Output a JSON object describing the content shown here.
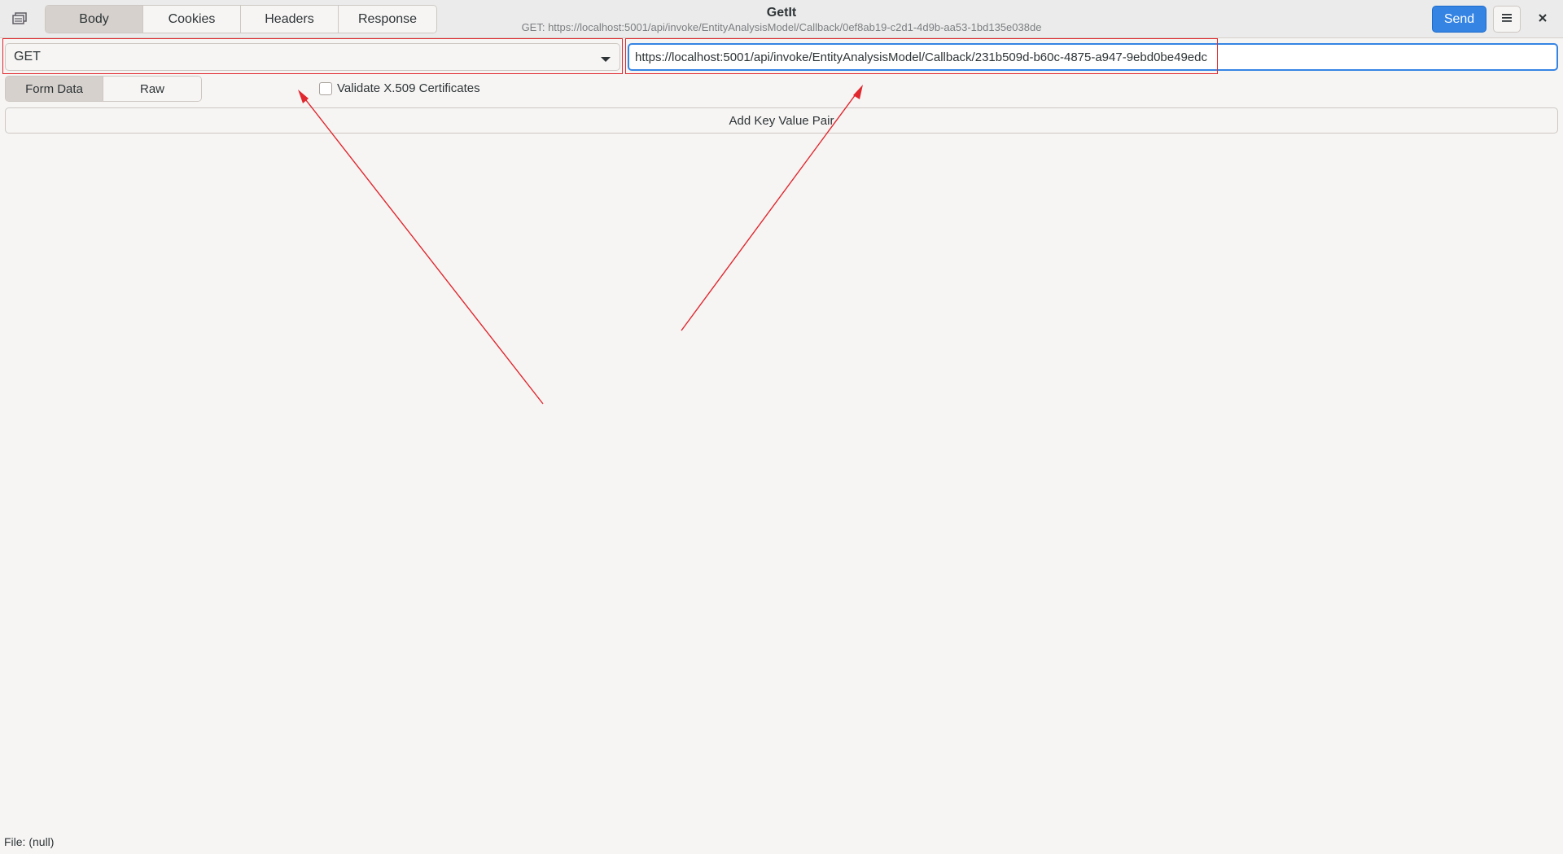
{
  "window": {
    "title": "GetIt",
    "subtitle": "GET: https://localhost:5001/api/invoke/EntityAnalysisModel/Callback/0ef8ab19-c2d1-4d9b-aa53-1bd135e038de"
  },
  "header": {
    "app_icon": "window-stack-icon",
    "tabs": [
      {
        "label": "Body",
        "active": true
      },
      {
        "label": "Cookies",
        "active": false
      },
      {
        "label": "Headers",
        "active": false
      },
      {
        "label": "Response",
        "active": false
      }
    ],
    "send_label": "Send",
    "menu_icon": "hamburger-menu-icon",
    "close_icon": "close-icon"
  },
  "request": {
    "method": "GET",
    "url": "https://localhost:5001/api/invoke/EntityAnalysisModel/Callback/231b509d-b60c-4875-a947-9ebd0be49edc"
  },
  "body_tabs": [
    {
      "label": "Form Data",
      "active": true
    },
    {
      "label": "Raw",
      "active": false
    }
  ],
  "validate": {
    "label": "Validate X.509 Certificates",
    "checked": false
  },
  "add_kv_label": "Add Key Value Pair",
  "status": "File: (null)",
  "colors": {
    "accent": "#3584e4",
    "annotation": "#e0282e",
    "background": "#f6f5f4"
  }
}
